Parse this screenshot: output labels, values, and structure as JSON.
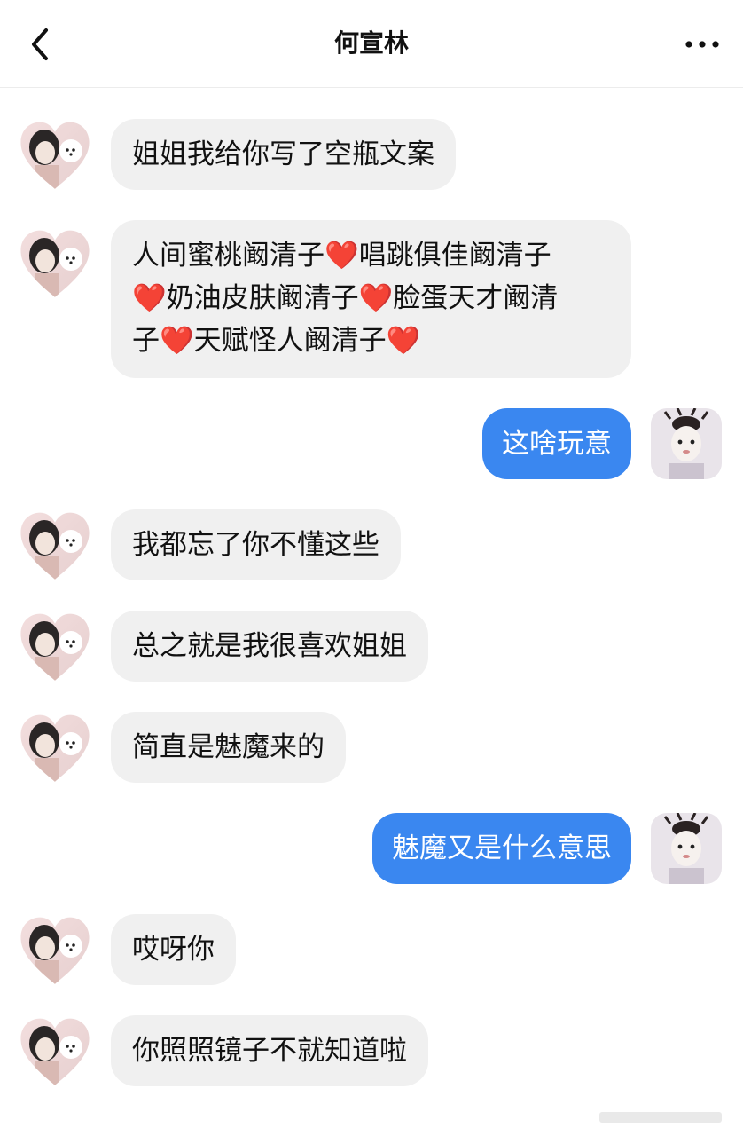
{
  "header": {
    "title": "何宣林",
    "back_icon": "chevron-left-icon",
    "more_icon": "more-dots-icon"
  },
  "messages": [
    {
      "side": "in",
      "text": "姐姐我给你写了空瓶文案"
    },
    {
      "side": "in",
      "lines": [
        "人间蜜桃阚清子❤️唱跳俱佳阚清子",
        "❤️奶油皮肤阚清子❤️脸蛋天才阚清",
        "子❤️天赋怪人阚清子❤️"
      ]
    },
    {
      "side": "out",
      "text": "这啥玩意"
    },
    {
      "side": "in",
      "text": "我都忘了你不懂这些"
    },
    {
      "side": "in",
      "text": "总之就是我很喜欢姐姐"
    },
    {
      "side": "in",
      "text": "简直是魅魔来的"
    },
    {
      "side": "out",
      "text": "魅魔又是什么意思"
    },
    {
      "side": "in",
      "text": "哎呀你"
    },
    {
      "side": "in",
      "text": "你照照镜子不就知道啦"
    }
  ],
  "colors": {
    "incoming_bubble": "#f0f0f0",
    "outgoing_bubble": "#3a87f0",
    "heart": "#e0212f"
  }
}
